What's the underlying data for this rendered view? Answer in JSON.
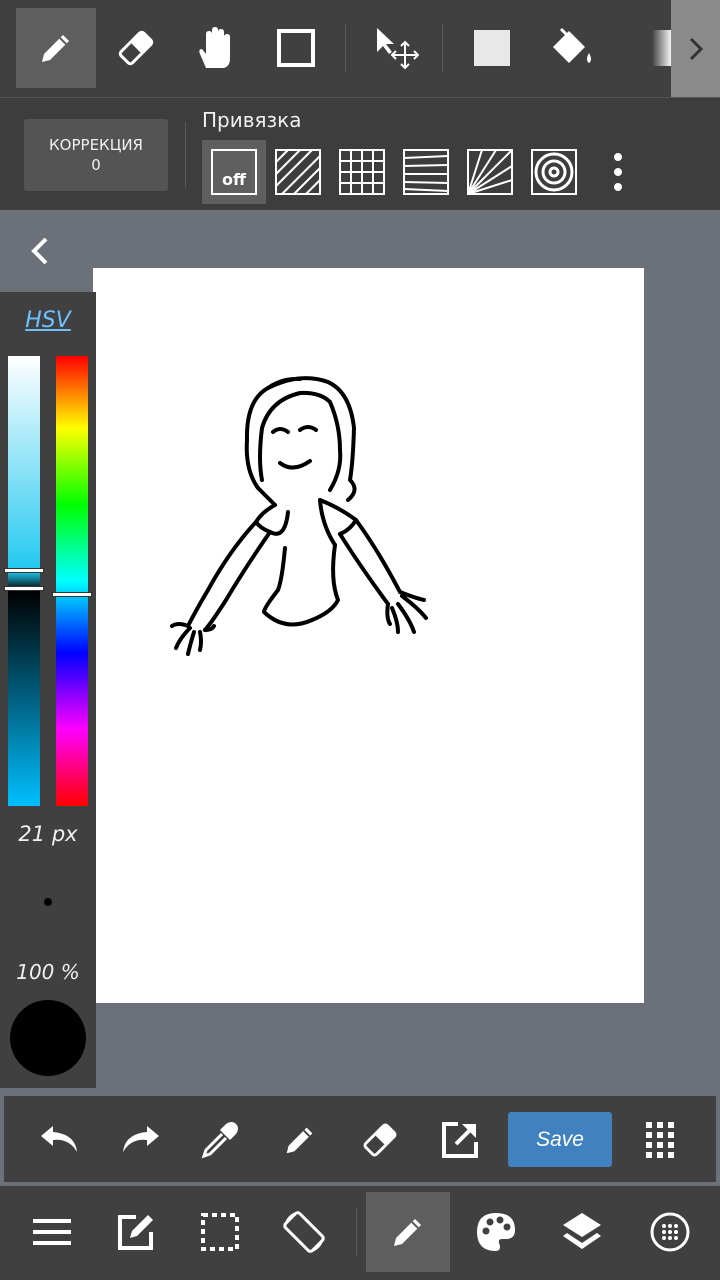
{
  "snap": {
    "correction_label": "КОРРЕКЦИЯ",
    "correction_value": "0",
    "title": "Привязка",
    "off_label": "off"
  },
  "color_panel": {
    "mode_label": "HSV",
    "brush_size": "21 px",
    "opacity": "100 %",
    "current_color": "#000000"
  },
  "action_bar": {
    "save_label": "Save"
  },
  "colors": {
    "toolbar_bg": "#404040",
    "workspace_bg": "#6b7079",
    "accent": "#3f82bf",
    "hsv_link": "#6ec1ff"
  }
}
